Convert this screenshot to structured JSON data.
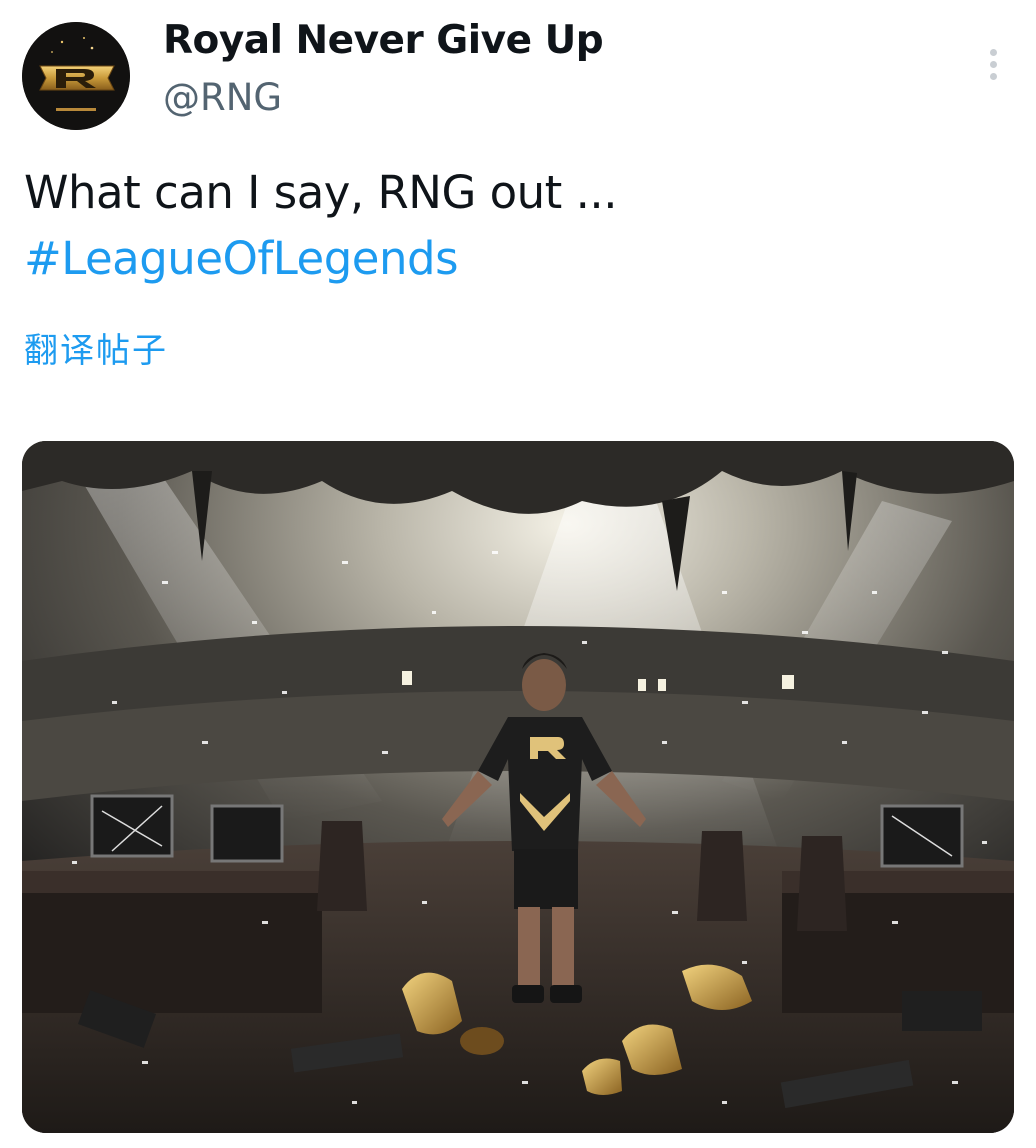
{
  "author": {
    "display_name": "Royal Never Give Up",
    "handle": "@RNG",
    "avatar_icon": "rng-logo-icon"
  },
  "menu": {
    "icon": "more-vertical-icon"
  },
  "tweet": {
    "text_line1": "What can I say, RNG out ...",
    "hashtag": "#LeagueOfLegends",
    "translate_label": "翻译帖子"
  },
  "media": {
    "jersey_logo": "R",
    "icon": "esports-arena-image"
  },
  "colors": {
    "link": "#1d9bf0",
    "text": "#0f1419",
    "secondary": "#536471"
  }
}
